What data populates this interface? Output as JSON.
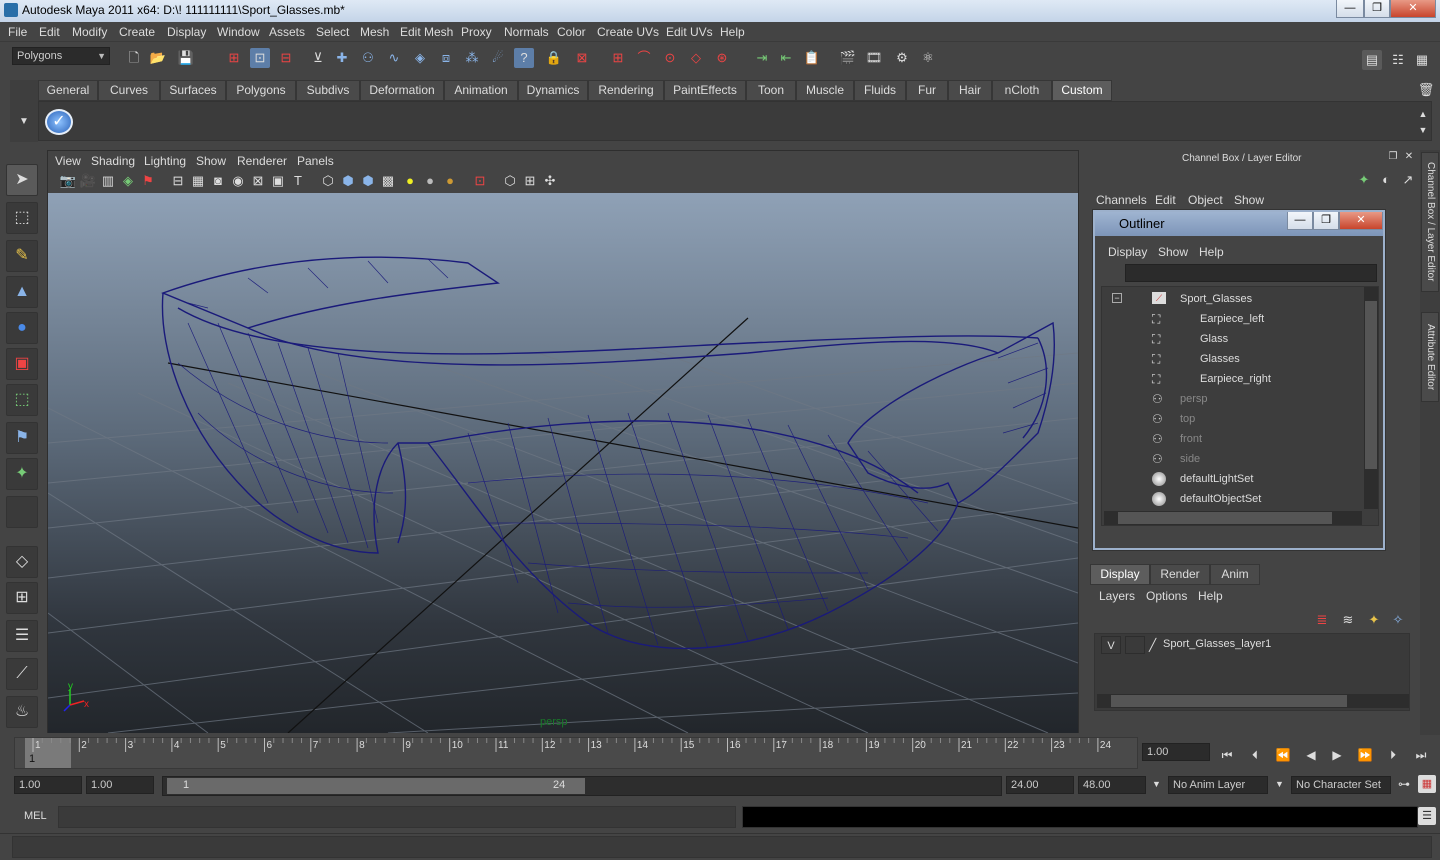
{
  "window": {
    "title": "Autodesk Maya 2011 x64: D:\\! 111111111\\Sport_Glasses.mb*",
    "min": "—",
    "max": "❐",
    "close": "✕"
  },
  "menubar": [
    "File",
    "Edit",
    "Modify",
    "Create",
    "Display",
    "Window",
    "Assets",
    "Select",
    "Mesh",
    "Edit Mesh",
    "Proxy",
    "Normals",
    "Color",
    "Create UVs",
    "Edit UVs",
    "Help"
  ],
  "statusline": {
    "menuset": "Polygons"
  },
  "shelf": {
    "tabs": [
      "General",
      "Curves",
      "Surfaces",
      "Polygons",
      "Subdivs",
      "Deformation",
      "Animation",
      "Dynamics",
      "Rendering",
      "PaintEffects",
      "Toon",
      "Muscle",
      "Fluids",
      "Fur",
      "Hair",
      "nCloth",
      "Custom"
    ],
    "active_tab": "Custom"
  },
  "viewport": {
    "menus": [
      "View",
      "Shading",
      "Lighting",
      "Show",
      "Renderer",
      "Panels"
    ],
    "camera_label": "persp",
    "axis": {
      "y": "y",
      "x": "x"
    },
    "wire_color": "#1a1a7a"
  },
  "channelbox": {
    "title": "Channel Box / Layer Editor",
    "menus": [
      "Channels",
      "Edit",
      "Object",
      "Show"
    ]
  },
  "outliner": {
    "title": "Outliner",
    "menus": [
      "Display",
      "Show",
      "Help"
    ],
    "items": [
      {
        "label": "Sport_Glasses",
        "dim": false
      },
      {
        "label": "Earpiece_left",
        "dim": false
      },
      {
        "label": "Glass",
        "dim": false
      },
      {
        "label": "Glasses",
        "dim": false
      },
      {
        "label": "Earpiece_right",
        "dim": false
      },
      {
        "label": "persp",
        "dim": true
      },
      {
        "label": "top",
        "dim": true
      },
      {
        "label": "front",
        "dim": true
      },
      {
        "label": "side",
        "dim": true
      },
      {
        "label": "defaultLightSet",
        "dim": false
      },
      {
        "label": "defaultObjectSet",
        "dim": false
      }
    ]
  },
  "layer_editor": {
    "tabs": [
      "Display",
      "Render",
      "Anim"
    ],
    "active_tab": "Display",
    "menus": [
      "Layers",
      "Options",
      "Help"
    ],
    "layer": {
      "visible": "V",
      "name": "Sport_Glasses_layer1"
    }
  },
  "side_tabs": [
    "Channel Box / Layer Editor",
    "Attribute Editor"
  ],
  "timeline": {
    "ticks": [
      "1",
      "2",
      "3",
      "4",
      "5",
      "6",
      "7",
      "8",
      "9",
      "10",
      "11",
      "12",
      "13",
      "14",
      "15",
      "16",
      "17",
      "18",
      "19",
      "20",
      "21",
      "22",
      "23",
      "24"
    ],
    "current_frame_marker": "1",
    "current_time": "1.00"
  },
  "range": {
    "start": "1.00",
    "playback_start": "1.00",
    "slider_start": "1",
    "slider_end": "24",
    "playback_end": "24.00",
    "end": "48.00",
    "anim_layer": "No Anim Layer",
    "character_set": "No Character Set"
  },
  "cmdline": {
    "label": "MEL"
  }
}
